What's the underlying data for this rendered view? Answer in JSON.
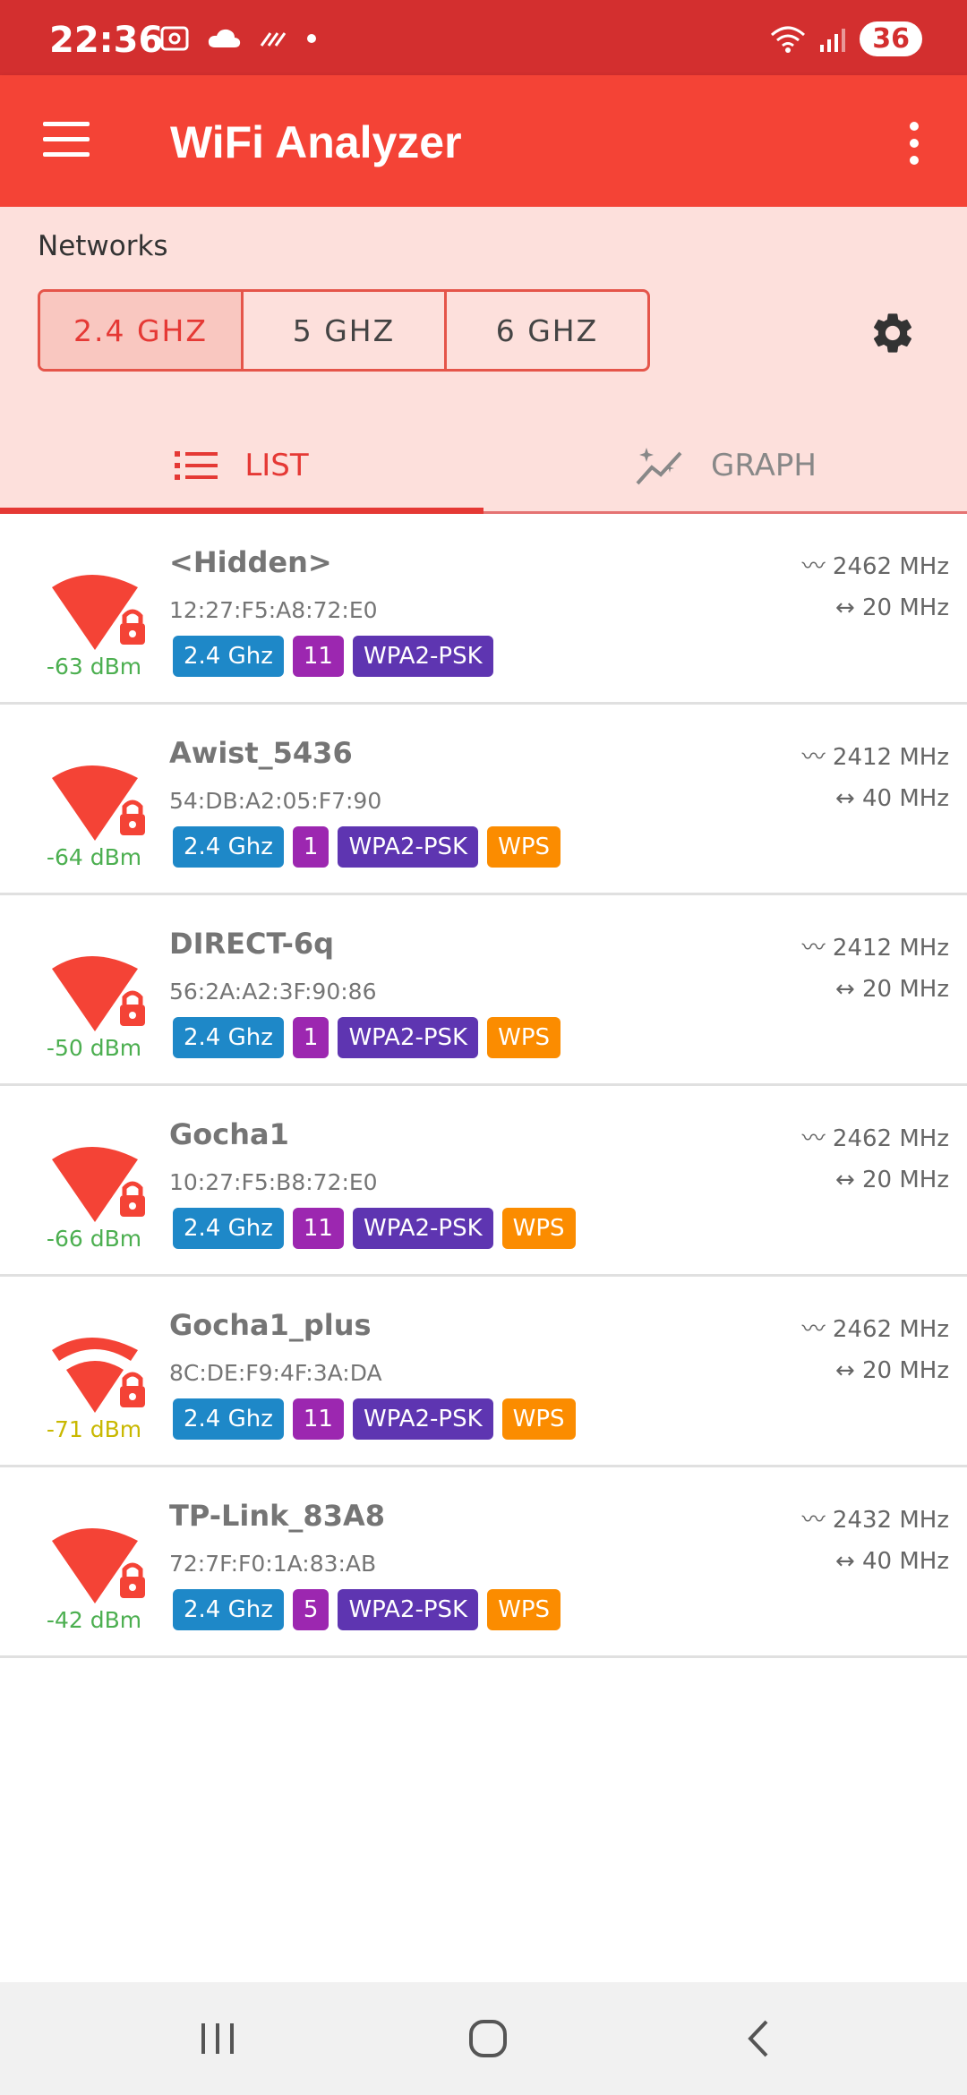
{
  "status_bar": {
    "time": "22:36",
    "battery": "36",
    "icons_left": [
      "photo-icon",
      "cloud-icon",
      "data-saver-icon",
      "dot-icon"
    ],
    "icons_right": [
      "wifi-icon",
      "cell-signal-icon"
    ]
  },
  "app_bar": {
    "title": "WiFi Analyzer"
  },
  "header": {
    "networks_label": "Networks",
    "bands": [
      "2.4 GHZ",
      "5 GHZ",
      "6 GHZ"
    ],
    "selected_band": "2.4 GHZ"
  },
  "tabs": {
    "list_label": "LIST",
    "graph_label": "GRAPH",
    "active": "LIST"
  },
  "networks": [
    {
      "ssid": "<Hidden>",
      "bssid": "12:27:F5:A8:72:E0",
      "dbm": "-63 dBm",
      "dbm_color": "#4caf50",
      "band": "2.4 Ghz",
      "channel": "11",
      "security": "WPA2-PSK",
      "wps": "",
      "freq": "2462 MHz",
      "width": "20 MHz",
      "strength_level": "full"
    },
    {
      "ssid": "Awist_5436",
      "bssid": "54:DB:A2:05:F7:90",
      "dbm": "-64 dBm",
      "dbm_color": "#4caf50",
      "band": "2.4 Ghz",
      "channel": "1",
      "security": "WPA2-PSK",
      "wps": "WPS",
      "freq": "2412 MHz",
      "width": "40 MHz",
      "strength_level": "full"
    },
    {
      "ssid": "DIRECT-6q",
      "bssid": "56:2A:A2:3F:90:86",
      "dbm": "-50 dBm",
      "dbm_color": "#4caf50",
      "band": "2.4 Ghz",
      "channel": "1",
      "security": "WPA2-PSK",
      "wps": "WPS",
      "freq": "2412 MHz",
      "width": "20 MHz",
      "strength_level": "full"
    },
    {
      "ssid": "Gocha1",
      "bssid": "10:27:F5:B8:72:E0",
      "dbm": "-66 dBm",
      "dbm_color": "#4caf50",
      "band": "2.4 Ghz",
      "channel": "11",
      "security": "WPA2-PSK",
      "wps": "WPS",
      "freq": "2462 MHz",
      "width": "20 MHz",
      "strength_level": "full"
    },
    {
      "ssid": "Gocha1_plus",
      "bssid": "8C:DE:F9:4F:3A:DA",
      "dbm": "-71 dBm",
      "dbm_color": "#c9b800",
      "band": "2.4 Ghz",
      "channel": "11",
      "security": "WPA2-PSK",
      "wps": "WPS",
      "freq": "2462 MHz",
      "width": "20 MHz",
      "strength_level": "partial"
    },
    {
      "ssid": "TP-Link_83A8",
      "bssid": "72:7F:F0:1A:83:AB",
      "dbm": "-42 dBm",
      "dbm_color": "#4caf50",
      "band": "2.4 Ghz",
      "channel": "5",
      "security": "WPA2-PSK",
      "wps": "WPS",
      "freq": "2432 MHz",
      "width": "40 MHz",
      "strength_level": "full"
    }
  ],
  "colors": {
    "status_bar": "#d32f2f",
    "app_bar": "#f44336",
    "header_panel": "#fde0dc",
    "accent": "#e53935",
    "signal_icon": "#f44336",
    "tag_band": "#1e88c8",
    "tag_channel": "#9c27b0",
    "tag_security": "#5e35b1",
    "tag_wps": "#fb8c00"
  },
  "nav_bar": {
    "buttons": [
      "recents-icon",
      "home-icon",
      "back-icon"
    ]
  }
}
